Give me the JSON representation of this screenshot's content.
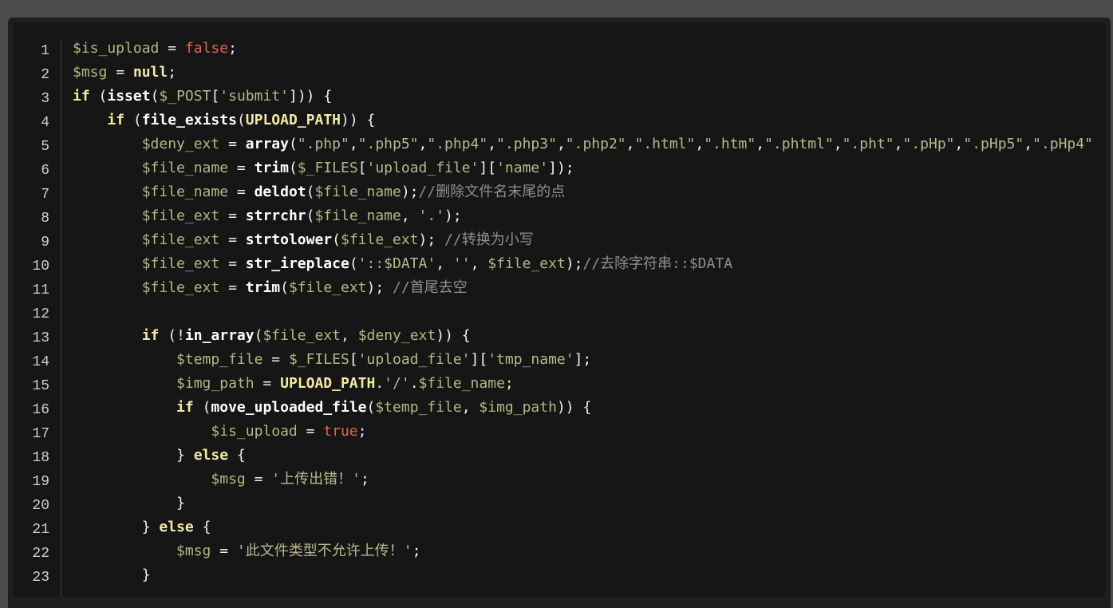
{
  "editor": {
    "theme_colors": {
      "page_background": "#4b4b4b",
      "panel_background": "#161616",
      "line_number": "#cfcfcf",
      "variable": "#b5b882",
      "keyword": "#f3e9a1",
      "literal": "#e0674b",
      "function": "#ffffff",
      "string": "#b9b98d",
      "comment": "#8f8f8f",
      "text": "#f1f1f1"
    },
    "lines": [
      {
        "n": "1",
        "tokens": [
          {
            "t": "var",
            "v": "$is_upload"
          },
          {
            "t": "txt",
            "v": " = "
          },
          {
            "t": "lit",
            "v": "false"
          },
          {
            "t": "txt",
            "v": ";"
          }
        ]
      },
      {
        "n": "2",
        "tokens": [
          {
            "t": "var",
            "v": "$msg"
          },
          {
            "t": "txt",
            "v": " = "
          },
          {
            "t": "kw",
            "v": "null"
          },
          {
            "t": "txt",
            "v": ";"
          }
        ]
      },
      {
        "n": "3",
        "tokens": [
          {
            "t": "kw",
            "v": "if"
          },
          {
            "t": "txt",
            "v": " ("
          },
          {
            "t": "fn",
            "v": "isset"
          },
          {
            "t": "txt",
            "v": "("
          },
          {
            "t": "var",
            "v": "$_POST"
          },
          {
            "t": "txt",
            "v": "["
          },
          {
            "t": "str",
            "v": "'submit'"
          },
          {
            "t": "txt",
            "v": "])) {"
          }
        ]
      },
      {
        "n": "4",
        "tokens": [
          {
            "t": "txt",
            "v": "    "
          },
          {
            "t": "kw",
            "v": "if"
          },
          {
            "t": "txt",
            "v": " ("
          },
          {
            "t": "fn",
            "v": "file_exists"
          },
          {
            "t": "txt",
            "v": "("
          },
          {
            "t": "con",
            "v": "UPLOAD_PATH"
          },
          {
            "t": "txt",
            "v": ")) {"
          }
        ]
      },
      {
        "n": "5",
        "tokens": [
          {
            "t": "txt",
            "v": "        "
          },
          {
            "t": "var",
            "v": "$deny_ext"
          },
          {
            "t": "txt",
            "v": " = "
          },
          {
            "t": "fn",
            "v": "array"
          },
          {
            "t": "txt",
            "v": "("
          },
          {
            "t": "str",
            "v": "\".php\""
          },
          {
            "t": "txt",
            "v": ","
          },
          {
            "t": "str",
            "v": "\".php5\""
          },
          {
            "t": "txt",
            "v": ","
          },
          {
            "t": "str",
            "v": "\".php4\""
          },
          {
            "t": "txt",
            "v": ","
          },
          {
            "t": "str",
            "v": "\".php3\""
          },
          {
            "t": "txt",
            "v": ","
          },
          {
            "t": "str",
            "v": "\".php2\""
          },
          {
            "t": "txt",
            "v": ","
          },
          {
            "t": "str",
            "v": "\".html\""
          },
          {
            "t": "txt",
            "v": ","
          },
          {
            "t": "str",
            "v": "\".htm\""
          },
          {
            "t": "txt",
            "v": ","
          },
          {
            "t": "str",
            "v": "\".phtml\""
          },
          {
            "t": "txt",
            "v": ","
          },
          {
            "t": "str",
            "v": "\".pht\""
          },
          {
            "t": "txt",
            "v": ","
          },
          {
            "t": "str",
            "v": "\".pHp\""
          },
          {
            "t": "txt",
            "v": ","
          },
          {
            "t": "str",
            "v": "\".pHp5\""
          },
          {
            "t": "txt",
            "v": ","
          },
          {
            "t": "str",
            "v": "\".pHp4\""
          }
        ]
      },
      {
        "n": "6",
        "tokens": [
          {
            "t": "txt",
            "v": "        "
          },
          {
            "t": "var",
            "v": "$file_name"
          },
          {
            "t": "txt",
            "v": " = "
          },
          {
            "t": "fn",
            "v": "trim"
          },
          {
            "t": "txt",
            "v": "("
          },
          {
            "t": "var",
            "v": "$_FILES"
          },
          {
            "t": "txt",
            "v": "["
          },
          {
            "t": "str",
            "v": "'upload_file'"
          },
          {
            "t": "txt",
            "v": "]["
          },
          {
            "t": "str",
            "v": "'name'"
          },
          {
            "t": "txt",
            "v": "]);"
          }
        ]
      },
      {
        "n": "7",
        "tokens": [
          {
            "t": "txt",
            "v": "        "
          },
          {
            "t": "var",
            "v": "$file_name"
          },
          {
            "t": "txt",
            "v": " = "
          },
          {
            "t": "fn",
            "v": "deldot"
          },
          {
            "t": "txt",
            "v": "("
          },
          {
            "t": "var",
            "v": "$file_name"
          },
          {
            "t": "txt",
            "v": ");"
          },
          {
            "t": "cmt",
            "v": "//删除文件名末尾的点"
          }
        ]
      },
      {
        "n": "8",
        "tokens": [
          {
            "t": "txt",
            "v": "        "
          },
          {
            "t": "var",
            "v": "$file_ext"
          },
          {
            "t": "txt",
            "v": " = "
          },
          {
            "t": "fn",
            "v": "strrchr"
          },
          {
            "t": "txt",
            "v": "("
          },
          {
            "t": "var",
            "v": "$file_name"
          },
          {
            "t": "txt",
            "v": ", "
          },
          {
            "t": "str",
            "v": "'.'"
          },
          {
            "t": "txt",
            "v": ");"
          }
        ]
      },
      {
        "n": "9",
        "tokens": [
          {
            "t": "txt",
            "v": "        "
          },
          {
            "t": "var",
            "v": "$file_ext"
          },
          {
            "t": "txt",
            "v": " = "
          },
          {
            "t": "fn",
            "v": "strtolower"
          },
          {
            "t": "txt",
            "v": "("
          },
          {
            "t": "var",
            "v": "$file_ext"
          },
          {
            "t": "txt",
            "v": "); "
          },
          {
            "t": "cmt",
            "v": "//转换为小写"
          }
        ]
      },
      {
        "n": "10",
        "tokens": [
          {
            "t": "txt",
            "v": "        "
          },
          {
            "t": "var",
            "v": "$file_ext"
          },
          {
            "t": "txt",
            "v": " = "
          },
          {
            "t": "fn",
            "v": "str_ireplace"
          },
          {
            "t": "txt",
            "v": "("
          },
          {
            "t": "str",
            "v": "'::$DATA'"
          },
          {
            "t": "txt",
            "v": ", "
          },
          {
            "t": "str",
            "v": "''"
          },
          {
            "t": "txt",
            "v": ", "
          },
          {
            "t": "var",
            "v": "$file_ext"
          },
          {
            "t": "txt",
            "v": ");"
          },
          {
            "t": "cmt",
            "v": "//去除字符串::$DATA"
          }
        ]
      },
      {
        "n": "11",
        "tokens": [
          {
            "t": "txt",
            "v": "        "
          },
          {
            "t": "var",
            "v": "$file_ext"
          },
          {
            "t": "txt",
            "v": " = "
          },
          {
            "t": "fn",
            "v": "trim"
          },
          {
            "t": "txt",
            "v": "("
          },
          {
            "t": "var",
            "v": "$file_ext"
          },
          {
            "t": "txt",
            "v": "); "
          },
          {
            "t": "cmt",
            "v": "//首尾去空"
          }
        ]
      },
      {
        "n": "12",
        "tokens": []
      },
      {
        "n": "13",
        "tokens": [
          {
            "t": "txt",
            "v": "        "
          },
          {
            "t": "kw",
            "v": "if"
          },
          {
            "t": "txt",
            "v": " (!"
          },
          {
            "t": "fn",
            "v": "in_array"
          },
          {
            "t": "txt",
            "v": "("
          },
          {
            "t": "var",
            "v": "$file_ext"
          },
          {
            "t": "txt",
            "v": ", "
          },
          {
            "t": "var",
            "v": "$deny_ext"
          },
          {
            "t": "txt",
            "v": ")) {"
          }
        ]
      },
      {
        "n": "14",
        "tokens": [
          {
            "t": "txt",
            "v": "            "
          },
          {
            "t": "var",
            "v": "$temp_file"
          },
          {
            "t": "txt",
            "v": " = "
          },
          {
            "t": "var",
            "v": "$_FILES"
          },
          {
            "t": "txt",
            "v": "["
          },
          {
            "t": "str",
            "v": "'upload_file'"
          },
          {
            "t": "txt",
            "v": "]["
          },
          {
            "t": "str",
            "v": "'tmp_name'"
          },
          {
            "t": "txt",
            "v": "];"
          }
        ]
      },
      {
        "n": "15",
        "tokens": [
          {
            "t": "txt",
            "v": "            "
          },
          {
            "t": "var",
            "v": "$img_path"
          },
          {
            "t": "txt",
            "v": " = "
          },
          {
            "t": "con",
            "v": "UPLOAD_PATH"
          },
          {
            "t": "txt",
            "v": "."
          },
          {
            "t": "str",
            "v": "'/'"
          },
          {
            "t": "txt",
            "v": "."
          },
          {
            "t": "var",
            "v": "$file_name"
          },
          {
            "t": "txt",
            "v": ";"
          }
        ]
      },
      {
        "n": "16",
        "tokens": [
          {
            "t": "txt",
            "v": "            "
          },
          {
            "t": "kw",
            "v": "if"
          },
          {
            "t": "txt",
            "v": " ("
          },
          {
            "t": "fn",
            "v": "move_uploaded_file"
          },
          {
            "t": "txt",
            "v": "("
          },
          {
            "t": "var",
            "v": "$temp_file"
          },
          {
            "t": "txt",
            "v": ", "
          },
          {
            "t": "var",
            "v": "$img_path"
          },
          {
            "t": "txt",
            "v": ")) {"
          }
        ]
      },
      {
        "n": "17",
        "tokens": [
          {
            "t": "txt",
            "v": "                "
          },
          {
            "t": "var",
            "v": "$is_upload"
          },
          {
            "t": "txt",
            "v": " = "
          },
          {
            "t": "lit",
            "v": "true"
          },
          {
            "t": "txt",
            "v": ";"
          }
        ]
      },
      {
        "n": "18",
        "tokens": [
          {
            "t": "txt",
            "v": "            } "
          },
          {
            "t": "kw",
            "v": "else"
          },
          {
            "t": "txt",
            "v": " {"
          }
        ]
      },
      {
        "n": "19",
        "tokens": [
          {
            "t": "txt",
            "v": "                "
          },
          {
            "t": "var",
            "v": "$msg"
          },
          {
            "t": "txt",
            "v": " = "
          },
          {
            "t": "str",
            "v": "'上传出错！'"
          },
          {
            "t": "txt",
            "v": ";"
          }
        ]
      },
      {
        "n": "20",
        "tokens": [
          {
            "t": "txt",
            "v": "            }"
          }
        ]
      },
      {
        "n": "21",
        "tokens": [
          {
            "t": "txt",
            "v": "        } "
          },
          {
            "t": "kw",
            "v": "else"
          },
          {
            "t": "txt",
            "v": " {"
          }
        ]
      },
      {
        "n": "22",
        "tokens": [
          {
            "t": "txt",
            "v": "            "
          },
          {
            "t": "var",
            "v": "$msg"
          },
          {
            "t": "txt",
            "v": " = "
          },
          {
            "t": "str",
            "v": "'此文件类型不允许上传！'"
          },
          {
            "t": "txt",
            "v": ";"
          }
        ]
      },
      {
        "n": "23",
        "tokens": [
          {
            "t": "txt",
            "v": "        }"
          }
        ]
      }
    ]
  }
}
